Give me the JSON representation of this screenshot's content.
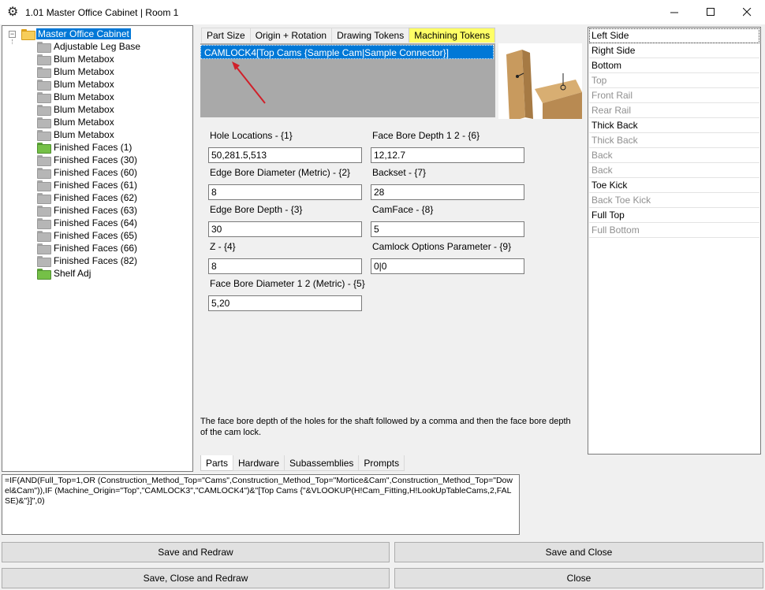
{
  "window": {
    "title": "1.01 Master Office Cabinet | Room 1"
  },
  "tree": {
    "root": "Master Office Cabinet",
    "items": [
      {
        "label": "Adjustable Leg Base",
        "color": "gray"
      },
      {
        "label": "Blum Metabox",
        "color": "gray"
      },
      {
        "label": "Blum Metabox",
        "color": "gray"
      },
      {
        "label": "Blum Metabox",
        "color": "gray"
      },
      {
        "label": "Blum Metabox",
        "color": "gray"
      },
      {
        "label": "Blum Metabox",
        "color": "gray"
      },
      {
        "label": "Blum Metabox",
        "color": "gray"
      },
      {
        "label": "Blum Metabox",
        "color": "gray"
      },
      {
        "label": "Finished Faces (1)",
        "color": "green"
      },
      {
        "label": "Finished Faces (30)",
        "color": "gray"
      },
      {
        "label": "Finished Faces (60)",
        "color": "gray"
      },
      {
        "label": "Finished Faces (61)",
        "color": "gray"
      },
      {
        "label": "Finished Faces (62)",
        "color": "gray"
      },
      {
        "label": "Finished Faces (63)",
        "color": "gray"
      },
      {
        "label": "Finished Faces (64)",
        "color": "gray"
      },
      {
        "label": "Finished Faces (65)",
        "color": "gray"
      },
      {
        "label": "Finished Faces (66)",
        "color": "gray"
      },
      {
        "label": "Finished Faces (82)",
        "color": "gray"
      },
      {
        "label": "Shelf Adj",
        "color": "green"
      }
    ]
  },
  "tabs": [
    "Part Size",
    "Origin + Rotation",
    "Drawing Tokens",
    "Machining Tokens"
  ],
  "active_tab": "Machining Tokens",
  "token_item": "CAMLOCK4[Top Cams {Sample Cam|Sample Connector}]",
  "fields": {
    "hole_locations": {
      "label": "Hole Locations - {1}",
      "value": "50,281.5,513"
    },
    "edge_bore_diameter": {
      "label": "Edge Bore Diameter (Metric) - {2}",
      "value": "8"
    },
    "edge_bore_depth": {
      "label": "Edge Bore Depth - {3}",
      "value": "30"
    },
    "z": {
      "label": "Z - {4}",
      "value": "8"
    },
    "face_bore_diameter": {
      "label": "Face Bore Diameter 1  2 (Metric) - {5}",
      "value": "5,20"
    },
    "face_bore_depth": {
      "label": "Face Bore Depth 1  2 - {6}",
      "value": "12,12.7"
    },
    "backset": {
      "label": "Backset - {7}",
      "value": "28"
    },
    "camface": {
      "label": "CamFace - {8}",
      "value": "5"
    },
    "camlock_options": {
      "label": "Camlock Options Parameter - {9}",
      "value": "0|0"
    }
  },
  "help_text": "The face bore depth of the holes for the shaft followed by a comma and then the face bore depth of the cam lock.",
  "bottom_tabs": [
    "Parts",
    "Hardware",
    "Subassemblies",
    "Prompts"
  ],
  "parts": [
    {
      "label": "Left Side",
      "enabled": true
    },
    {
      "label": "Right Side",
      "enabled": true
    },
    {
      "label": "Bottom",
      "enabled": true
    },
    {
      "label": "Top",
      "enabled": false
    },
    {
      "label": "Front Rail",
      "enabled": false
    },
    {
      "label": "Rear Rail",
      "enabled": false
    },
    {
      "label": "Thick Back",
      "enabled": true
    },
    {
      "label": "Thick Back",
      "enabled": false
    },
    {
      "label": "Back",
      "enabled": false
    },
    {
      "label": "Back",
      "enabled": false
    },
    {
      "label": "Toe Kick",
      "enabled": true
    },
    {
      "label": "Back Toe Kick",
      "enabled": false
    },
    {
      "label": "Full Top",
      "enabled": true
    },
    {
      "label": "Full Bottom",
      "enabled": false
    }
  ],
  "formula": "=IF(AND(Full_Top=1,OR (Construction_Method_Top=\"Cams\",Construction_Method_Top=\"Mortice&Cam\",Construction_Method_Top=\"Dowel&Cam\")),IF (Machine_Origin=\"Top\",\"CAMLOCK3\",\"CAMLOCK4\")&\"[Top Cams {\"&VLOOKUP(H!Cam_Fitting,H!LookUpTableCams,2,FALSE)&\"}]\",0)",
  "buttons": {
    "save_redraw": "Save and Redraw",
    "save_close": "Save and Close",
    "save_close_redraw": "Save, Close and Redraw",
    "close": "Close"
  },
  "colors": {
    "accent": "#0078d7",
    "active_tab": "#ffff66",
    "token_list_bg": "#a9a9a9"
  }
}
